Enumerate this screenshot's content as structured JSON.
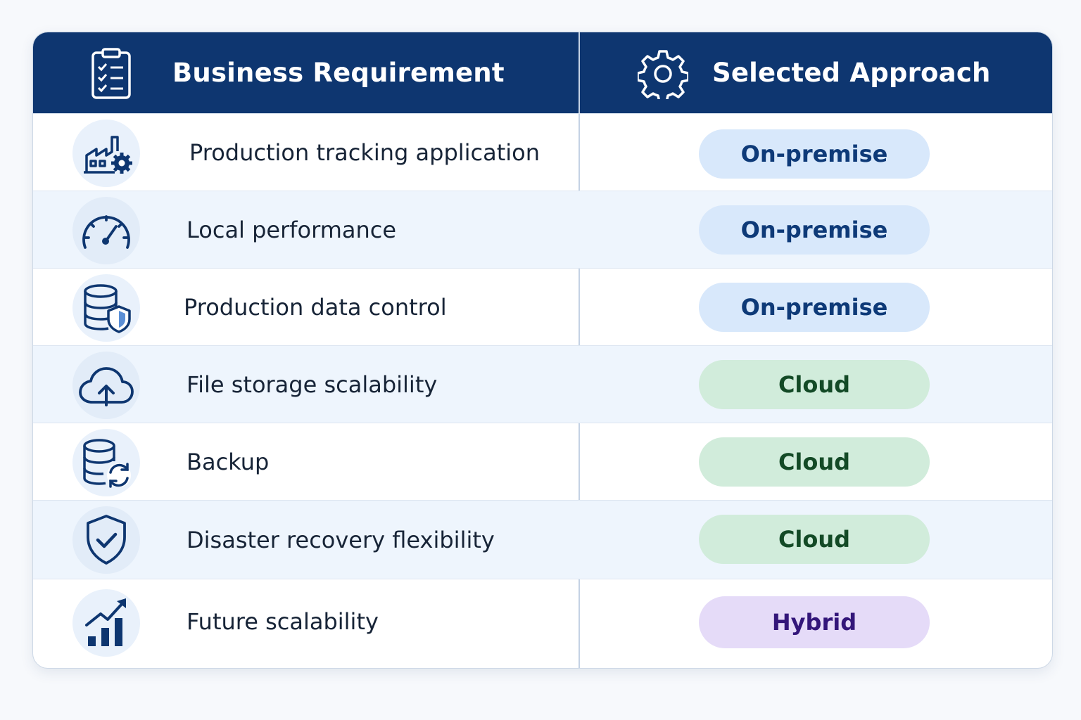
{
  "header": {
    "requirement_label": "Business Requirement",
    "approach_label": "Selected Approach",
    "requirement_icon": "clipboard-checklist-icon",
    "approach_icon": "gear-icon"
  },
  "colors": {
    "header_bg": "#0e3670",
    "on_premise_pill": "#d8e8fb",
    "cloud_pill": "#d1ecdb",
    "hybrid_pill": "#e5dbf8"
  },
  "rows": [
    {
      "requirement": "Production tracking application",
      "approach": "On-premise",
      "icon": "factory-gear-icon"
    },
    {
      "requirement": "Local performance",
      "approach": "On-premise",
      "icon": "speedometer-icon"
    },
    {
      "requirement": "Production data control",
      "approach": "On-premise",
      "icon": "database-shield-icon"
    },
    {
      "requirement": "File storage scalability",
      "approach": "Cloud",
      "icon": "cloud-upload-icon"
    },
    {
      "requirement": "Backup",
      "approach": "Cloud",
      "icon": "database-sync-icon"
    },
    {
      "requirement": "Disaster recovery flexibility",
      "approach": "Cloud",
      "icon": "shield-check-icon"
    },
    {
      "requirement": "Future scalability",
      "approach": "Hybrid",
      "icon": "growth-chart-icon"
    }
  ]
}
